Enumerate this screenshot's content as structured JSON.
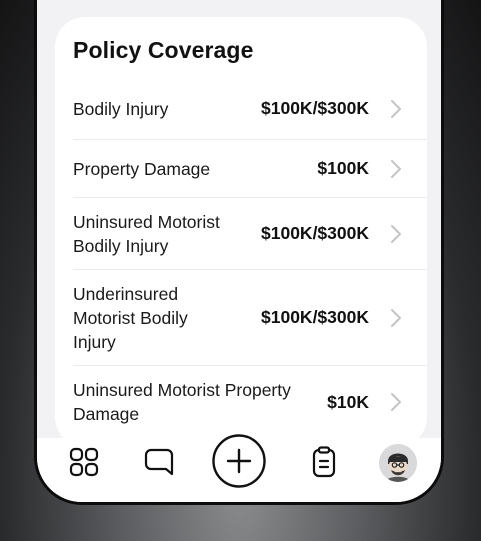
{
  "card": {
    "title": "Policy Coverage",
    "rows": [
      {
        "label": "Bodily Injury",
        "value": "$100K/$300K"
      },
      {
        "label": "Property Damage",
        "value": "$100K"
      },
      {
        "label": "Uninsured Motorist Bodily Injury",
        "value": "$100K/$300K"
      },
      {
        "label": "Underinsured Motorist Bodily Injury",
        "value": "$100K/$300K"
      },
      {
        "label": "Uninsured Motorist Property Damage",
        "value": "$10K"
      }
    ]
  },
  "tabbar": {
    "items": [
      {
        "icon": "grid-icon"
      },
      {
        "icon": "chat-bubble-icon"
      },
      {
        "icon": "plus-circle-icon"
      },
      {
        "icon": "clipboard-icon"
      },
      {
        "icon": "avatar"
      }
    ]
  },
  "colors": {
    "card_bg": "#ffffff",
    "screen_bg": "#f2f2f4",
    "text": "#111111",
    "chevron": "#c4c4c8"
  }
}
